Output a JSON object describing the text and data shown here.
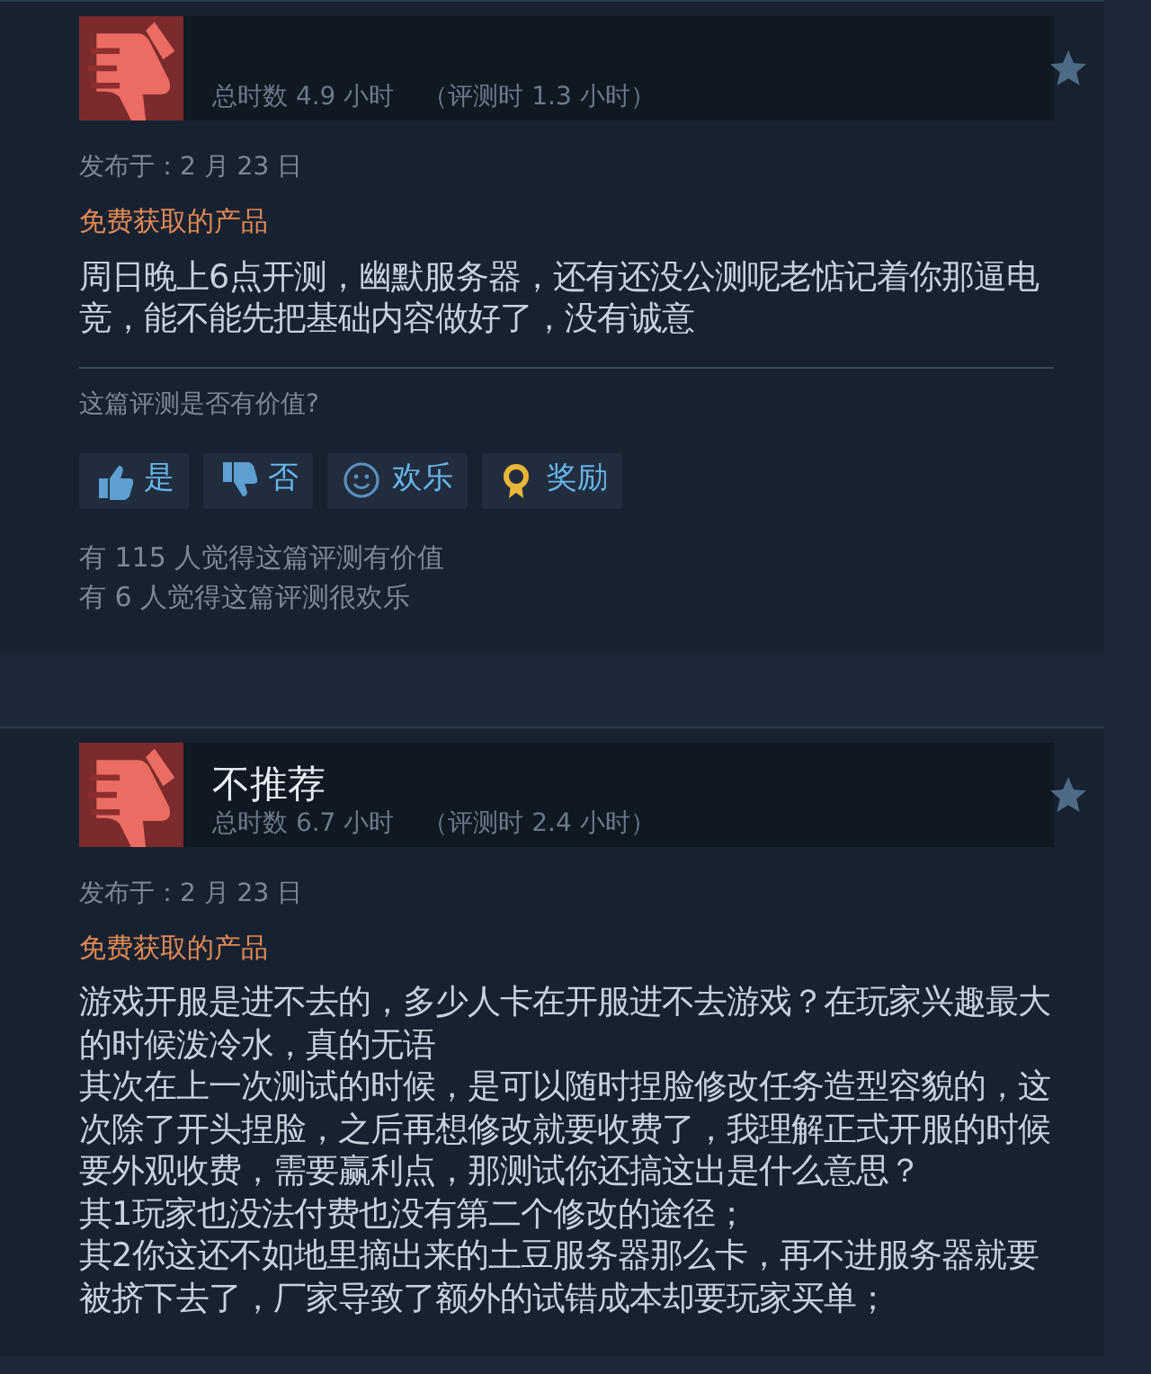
{
  "reviews": [
    {
      "recommended": false,
      "hours": "总时数 4.9 小时",
      "review_hours": "（评测时 1.3 小时）",
      "posted": "发布于：2 月 23 日",
      "free_label": "免费获取的产品",
      "body": [
        "周日晚上6点开测，幽默服务器，还有还没公测呢老惦记着你那逼电竞，能不能先把基础内容做好了，没有诚意"
      ],
      "helpful": {
        "prompt": "这篇评测是否有价值?",
        "buttons": [
          {
            "kind": "yes",
            "label": "是"
          },
          {
            "kind": "no",
            "label": "否"
          },
          {
            "kind": "funny",
            "label": "欢乐"
          },
          {
            "kind": "award",
            "label": "奖励"
          }
        ],
        "votes": [
          "有 115 人觉得这篇评测有价值",
          "有 6 人觉得这篇评测很欢乐"
        ]
      }
    },
    {
      "recommended": false,
      "title": "不推荐",
      "hours": "总时数 6.7 小时",
      "review_hours": "（评测时 2.4 小时）",
      "posted": "发布于：2 月 23 日",
      "free_label": "免费获取的产品",
      "body": [
        "游戏开服是进不去的，多少人卡在开服进不去游戏？在玩家兴趣最大的时候泼冷水，真的无语",
        "其次在上一次测试的时候，是可以随时捏脸修改任务造型容貌的，这次除了开头捏脸，之后再想修改就要收费了，我理解正式开服的时候要外观收费，需要赢利点，那测试你还搞这出是什么意思？",
        "其1玩家也没法付费也没有第二个修改的途径；",
        "其2你这还不如地里摘出来的土豆服务器那么卡，再不进服务器就要被挤下去了，厂家导致了额外的试错成本却要玩家买单；"
      ]
    }
  ]
}
